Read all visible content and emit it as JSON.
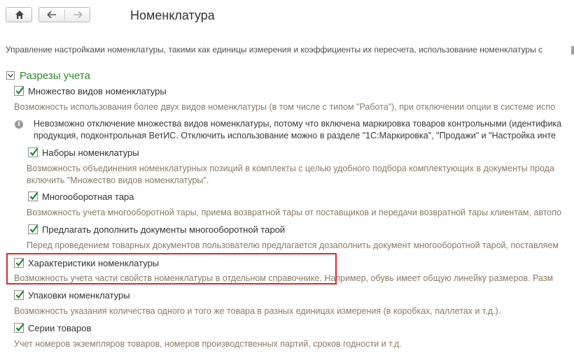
{
  "header": {
    "title": "Номенклатура",
    "description": "Управление настройками номенклатуры, такими как единицы измерения и коэффициенты их пересчета, использование номенклатуры с"
  },
  "group": {
    "title": "Разрезы учета"
  },
  "options": {
    "multiple_kinds": {
      "label": "Множество видов номенклатуры",
      "hint": "Возможность использования более двух видов номенклатуры (в том числе с типом \"Работа\"), при отключении опции в системе испо",
      "checked": true
    },
    "info": {
      "line1": "Невозможно отключение множества видов номенклатуры, потому что включена маркировка товаров контрольными (идентифика",
      "line2": "продукция, подконтрольная ВетИС. Отключить использование можно в разделе \"1С:Маркировка\", \"Продажи\" и \"Настройка инте"
    },
    "kits": {
      "label": "Наборы номенклатуры",
      "hint1": "Возможность объединения номенклатурных позиций в комплекты с целью удобного подбора комплектующих в документы прода",
      "hint2": "включить \"Множество видов номенклатуры\".",
      "checked": true
    },
    "returnable_tare": {
      "label": "Многооборотная тара",
      "hint": "Возможность учета многооборотной тары, приема возвратной тары от поставщиков и передачи возвратной тары клиентам, автопо",
      "checked": true
    },
    "suggest_tare": {
      "label": "Предлагать дополнить документы многооборотной тарой",
      "hint": "Перед проведением товарных документов пользователю предлагается дозаполнить документ многооборотной тарой, поставляем",
      "checked": true
    },
    "characteristics": {
      "label": "Характеристики номенклатуры",
      "hint": "Возможность учета части свойств номенклатуры в отдельном справочнике. Например, обувь имеет общую линейку размеров. Разм",
      "checked": true
    },
    "packages": {
      "label": "Упаковки номенклатуры",
      "hint": "Возможность указания количества одного и того же товара в разных единицах измерения (в коробках, паллетах и т.д.).",
      "checked": true
    },
    "series": {
      "label": "Серии товаров",
      "hint": "Учет номеров экземпляров товаров, номеров производственных партий, сроков годности и т.д.",
      "checked": true
    }
  },
  "colors": {
    "group_title": "#2e8b2e",
    "hint_text": "#8a7a66",
    "checkmark": "#1f8a2e",
    "highlight_border": "#e3262c"
  }
}
